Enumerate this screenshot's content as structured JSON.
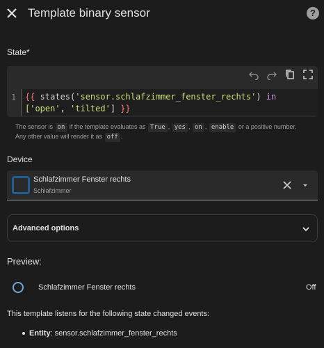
{
  "header": {
    "title": "Template binary sensor",
    "help_glyph": "?"
  },
  "state": {
    "label": "State*",
    "gutter_line": "1",
    "code_line1_part1": "{{",
    "code_line1_part2": " states(",
    "code_line1_part3": "'sensor.schlafzimmer_fenster_rechts'",
    "code_line1_part4": ") ",
    "code_line1_part5": "in",
    "code_line2_part1": "['open'",
    "code_line2_part2": ", ",
    "code_line2_part3": "'tilted'",
    "code_line2_part4": "] ",
    "code_line2_part5": "}}",
    "hint_part1": "The sensor is",
    "chip_on": "on",
    "hint_part2": "if the template evaluates as",
    "chip_true": "True",
    "chip_yes": "yes",
    "chip_on2": "on",
    "chip_enable": "enable",
    "hint_part3": "or a positive number.",
    "hint_part4": "Any other value will render it as",
    "chip_off": "off",
    "hint_part5": "."
  },
  "device": {
    "label": "Device",
    "name": "Schlafzimmer Fenster rechts",
    "area": "Schlafzimmer"
  },
  "advanced": {
    "label": "Advanced options"
  },
  "preview": {
    "label": "Preview:",
    "entity_name": "Schlafzimmer Fenster rechts",
    "state": "Off",
    "listen_text": "This template listens for the following state changed events:",
    "entity_key": "Entity",
    "entity_value": ": sensor.schlafzimmer_fenster_rechts"
  },
  "colors": {
    "background": "#1c1c1c",
    "accent": "#6fa8dc",
    "device_icon": "#1f5f8f"
  }
}
